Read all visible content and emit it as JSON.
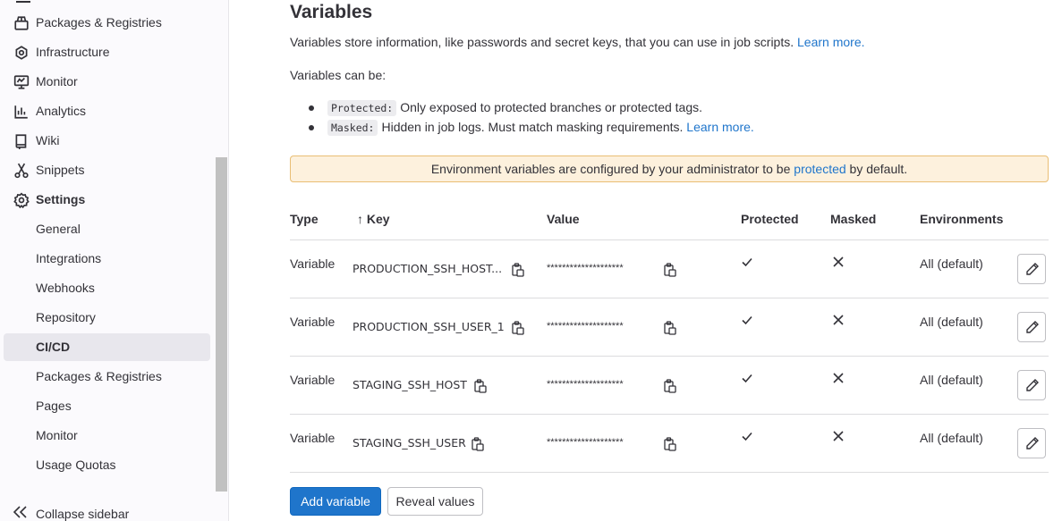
{
  "sidebar": {
    "items": [
      {
        "label": "Packages & Registries",
        "icon": "package-icon"
      },
      {
        "label": "Infrastructure",
        "icon": "cloud-gear-icon"
      },
      {
        "label": "Monitor",
        "icon": "monitor-icon"
      },
      {
        "label": "Analytics",
        "icon": "chart-icon"
      },
      {
        "label": "Wiki",
        "icon": "book-icon"
      },
      {
        "label": "Snippets",
        "icon": "scissors-icon"
      },
      {
        "label": "Settings",
        "icon": "gear-icon"
      }
    ],
    "settings_subitems": [
      {
        "label": "General"
      },
      {
        "label": "Integrations"
      },
      {
        "label": "Webhooks"
      },
      {
        "label": "Repository"
      },
      {
        "label": "CI/CD",
        "active": true
      },
      {
        "label": "Packages & Registries"
      },
      {
        "label": "Pages"
      },
      {
        "label": "Monitor"
      },
      {
        "label": "Usage Quotas"
      }
    ],
    "collapse_label": "Collapse sidebar"
  },
  "main": {
    "title": "Variables",
    "intro_text": "Variables store information, like passwords and secret keys, that you can use in job scripts.",
    "intro_link": "Learn more.",
    "can_be": "Variables can be:",
    "bullets": [
      {
        "code": "Protected:",
        "text": "Only exposed to protected branches or protected tags.",
        "link": ""
      },
      {
        "code": "Masked:",
        "text": "Hidden in job logs. Must match masking requirements.",
        "link": "Learn more."
      }
    ],
    "alert": {
      "before": "Environment variables are configured by your administrator to be",
      "link": "protected",
      "after": "by default."
    },
    "table": {
      "headers": {
        "type": "Type",
        "sort_arrow": "↑",
        "key": "Key",
        "value": "Value",
        "protected": "Protected",
        "masked": "Masked",
        "environments": "Environments"
      },
      "rows": [
        {
          "type": "Variable",
          "key": "PRODUCTION_SSH_HOST...",
          "value": "********************",
          "protected": true,
          "masked": false,
          "env": "All (default)"
        },
        {
          "type": "Variable",
          "key": "PRODUCTION_SSH_USER_1",
          "value": "********************",
          "protected": true,
          "masked": false,
          "env": "All (default)"
        },
        {
          "type": "Variable",
          "key": "STAGING_SSH_HOST",
          "value": "********************",
          "protected": true,
          "masked": false,
          "env": "All (default)"
        },
        {
          "type": "Variable",
          "key": "STAGING_SSH_USER",
          "value": "********************",
          "protected": true,
          "masked": false,
          "env": "All (default)"
        }
      ]
    },
    "buttons": {
      "add": "Add variable",
      "reveal": "Reveal values"
    }
  },
  "colors": {
    "accent": "#1f75cb",
    "alert_bg": "#fdf1dd",
    "alert_border": "#e9be74",
    "active_nav_bg": "#e8e7ed"
  }
}
